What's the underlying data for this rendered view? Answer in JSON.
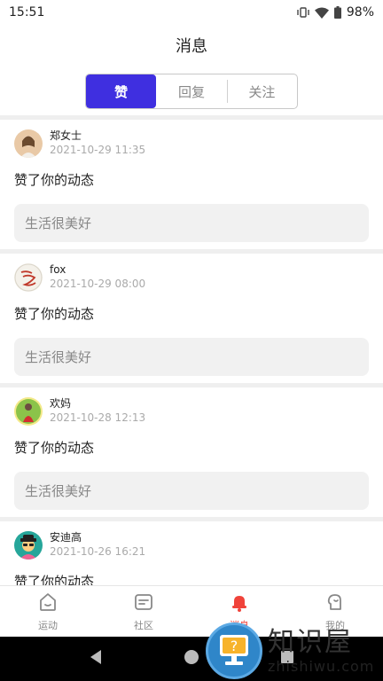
{
  "status_bar": {
    "time": "15:51",
    "battery": "98%"
  },
  "header": {
    "title": "消息"
  },
  "tabs": [
    {
      "label": "赞",
      "active": true
    },
    {
      "label": "回复",
      "active": false
    },
    {
      "label": "关注",
      "active": false
    }
  ],
  "feed": [
    {
      "name": "郑女士",
      "time": "2021-10-29 11:35",
      "action": "赞了你的动态",
      "quote": "生活很美好"
    },
    {
      "name": "fox",
      "time": "2021-10-29 08:00",
      "action": "赞了你的动态",
      "quote": "生活很美好"
    },
    {
      "name": "欢妈",
      "time": "2021-10-28 12:13",
      "action": "赞了你的动态",
      "quote": "生活很美好"
    },
    {
      "name": "安迪高",
      "time": "2021-10-26 16:21",
      "action": "赞了你的动态",
      "quote": ""
    }
  ],
  "bottom_nav": [
    {
      "label": "运动",
      "icon": "home-icon",
      "active": false
    },
    {
      "label": "社区",
      "icon": "community-icon",
      "active": false
    },
    {
      "label": "消息",
      "icon": "bell-icon",
      "active": true
    },
    {
      "label": "我的",
      "icon": "profile-icon",
      "active": false
    }
  ],
  "watermark": {
    "title": "知识屋",
    "url": "zhishiwu.com"
  },
  "colors": {
    "accent": "#3f2fe0",
    "active_tab": "#f0433a"
  }
}
